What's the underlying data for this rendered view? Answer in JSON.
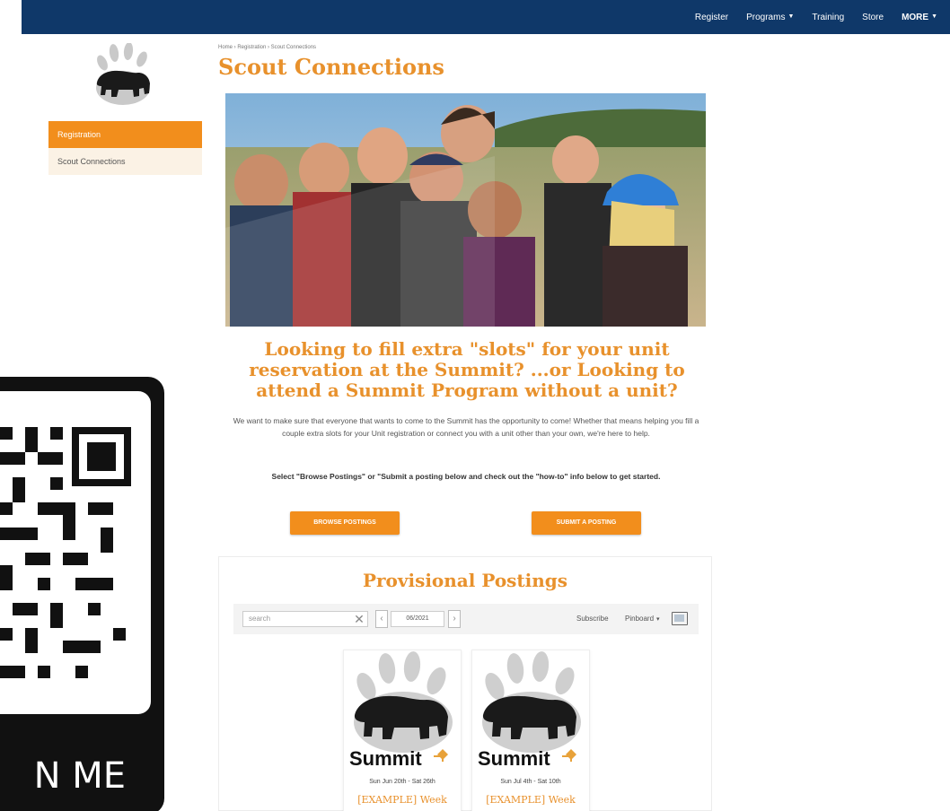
{
  "nav": {
    "items": [
      {
        "label": "Register",
        "dropdown": false,
        "bold": false
      },
      {
        "label": "Programs",
        "dropdown": true,
        "bold": false
      },
      {
        "label": "Training",
        "dropdown": false,
        "bold": false
      },
      {
        "label": "Store",
        "dropdown": false,
        "bold": false
      },
      {
        "label": "MORE",
        "dropdown": true,
        "bold": true
      }
    ]
  },
  "sidebar": {
    "items": [
      {
        "label": "Registration",
        "active": true
      },
      {
        "label": "Scout Connections",
        "active": false
      }
    ]
  },
  "breadcrumb": "Home › Registration › Scout Connections",
  "page_title": "Scout Connections",
  "headline": "Looking to fill extra \"slots\" for your unit reservation at the Summit? ...or Looking to attend a Summit Program without a unit?",
  "intro": "We want to make sure that everyone that wants to come to the Summit has the opportunity to come! Whether that means helping you fill a couple extra slots for your Unit registration or connect you with a unit other than your own, we're here to help.",
  "select_line": "Select \"Browse Postings\" or \"Submit a posting below and check out the \"how-to\" info below to get started.",
  "buttons": {
    "browse": "BROWSE POSTINGS",
    "submit": "SUBMIT A POSTING"
  },
  "postings": {
    "title": "Provisional Postings",
    "search_placeholder": "search",
    "date": "06/2021",
    "subscribe": "Subscribe",
    "pinboard": "Pinboard",
    "cards": [
      {
        "brand": "Summit",
        "date": "Sun Jun 20th - Sat 26th",
        "title": "[EXAMPLE] Week"
      },
      {
        "brand": "Summit",
        "date": "Sun Jul 4th - Sat 10th",
        "title": "[EXAMPLE] Week"
      }
    ]
  },
  "qr": {
    "caption": "N ME"
  },
  "colors": {
    "nav_bg": "#0f3869",
    "accent": "#f28e1c",
    "heading": "#e8912c"
  }
}
